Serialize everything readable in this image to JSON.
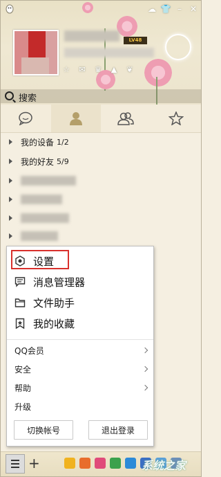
{
  "header": {
    "level_badge": "LV48",
    "search_label": "搜索"
  },
  "groups": [
    {
      "label": "我的设备",
      "count": "1/2"
    },
    {
      "label": "我的好友",
      "count": "5/9"
    }
  ],
  "menu": {
    "settings": "设置",
    "message_manager": "消息管理器",
    "file_assistant": "文件助手",
    "favorites": "我的收藏",
    "qq_vip": "QQ会员",
    "security": "安全",
    "help": "帮助",
    "upgrade": "升级",
    "switch_account": "切换帐号",
    "logout": "退出登录"
  },
  "footer": {
    "watermark": "系统之家"
  },
  "colors": {
    "highlight": "#d9302c",
    "menu_bg": "#ffffff",
    "panel_bg": "#f5efe1"
  }
}
